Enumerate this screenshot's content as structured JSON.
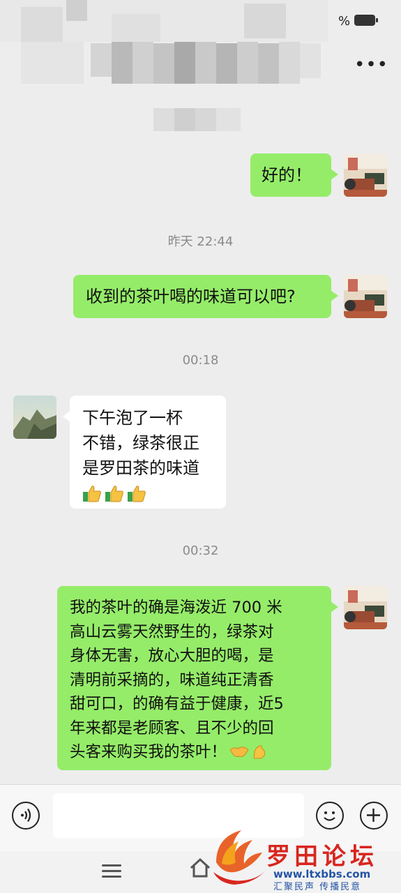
{
  "status": {
    "battery_pct_symbol": "%"
  },
  "header": {
    "more_label": "•••"
  },
  "timestamps": [
    "昨天 22:44",
    "00:18",
    "00:32"
  ],
  "messages": [
    {
      "sender": "me",
      "lines": [
        "好的！"
      ]
    },
    {
      "sender": "me",
      "lines": [
        "收到的茶叶喝的味道可以吧?"
      ]
    },
    {
      "sender": "other",
      "lines": [
        "下午泡了一杯",
        "不错，绿茶很正",
        "是罗田茶的味道"
      ],
      "emoji": [
        "thumbs-up-icon",
        "thumbs-up-icon",
        "thumbs-up-icon"
      ]
    },
    {
      "sender": "me",
      "lines": [
        "我的茶叶的确是海泼近 700 米",
        "高山云雾天然野生的，绿茶对",
        "身体无害，放心大胆的喝，是",
        "清明前采摘的，味道纯正清香",
        "甜可口，的确有益于健康，近5",
        "年来都是老顾客、且不少的回",
        "头客来购买我的茶叶！"
      ],
      "emoji": [
        "handshake-icon",
        "ok-hand-icon"
      ]
    }
  ],
  "input_bar": {
    "text": ""
  },
  "watermark": {
    "title": "罗田论坛",
    "url": "www.ltxbbs.com",
    "slogan": "汇聚民声 传播民意"
  },
  "colors": {
    "my_bubble": "#95ec69",
    "other_bubble": "#ffffff",
    "background": "#ededed",
    "watermark_red": "#d8261f",
    "watermark_blue": "#2453a4"
  }
}
